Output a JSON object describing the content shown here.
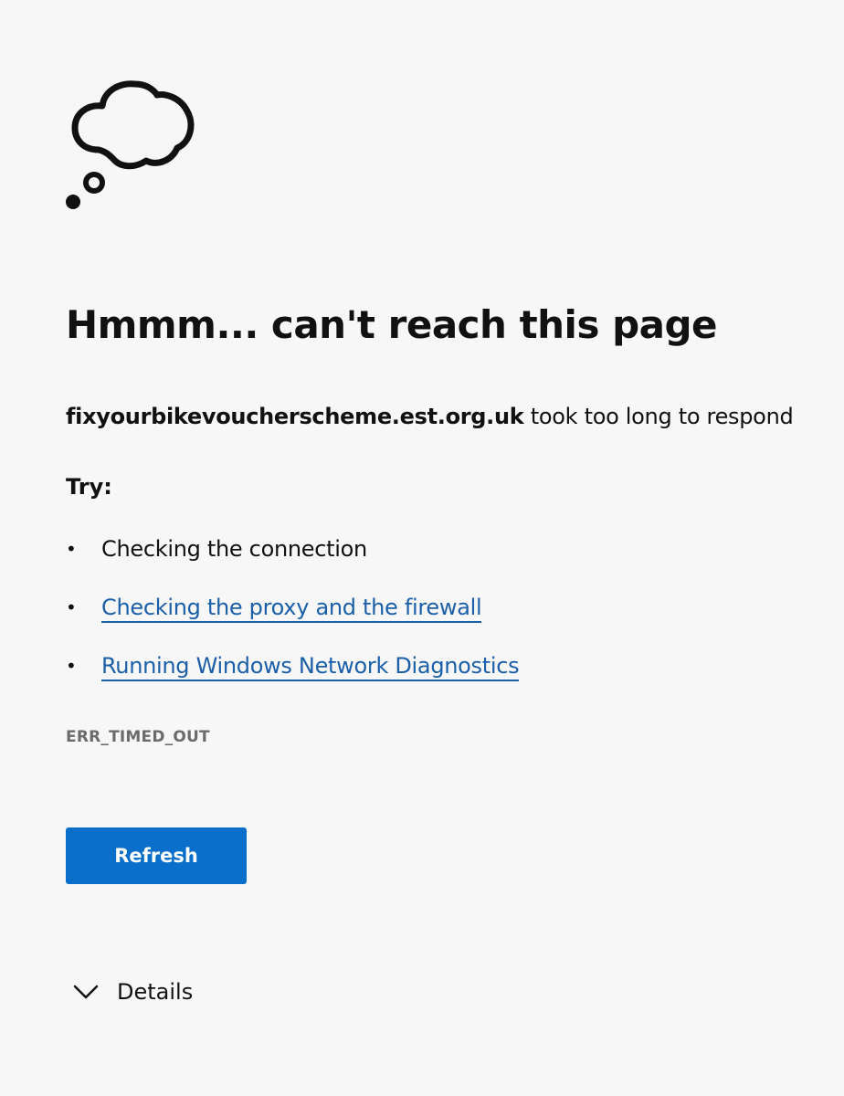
{
  "error_page": {
    "icon": "thought-cloud-icon",
    "title": "Hmmm... can't reach this page",
    "host": "fixyourbikevoucherscheme.est.org.uk",
    "message_suffix": " took too long to respond",
    "try_label": "Try:",
    "suggestions": [
      {
        "label": "Checking the connection",
        "link": false
      },
      {
        "label": "Checking the proxy and the firewall",
        "link": true
      },
      {
        "label": "Running Windows Network Diagnostics",
        "link": true
      }
    ],
    "error_code": "ERR_TIMED_OUT",
    "refresh_label": "Refresh",
    "details_label": "Details",
    "colors": {
      "background": "#f7f7f7",
      "link": "#1a5fa8",
      "button": "#0a6fca",
      "muted": "#6b6b6b"
    }
  }
}
